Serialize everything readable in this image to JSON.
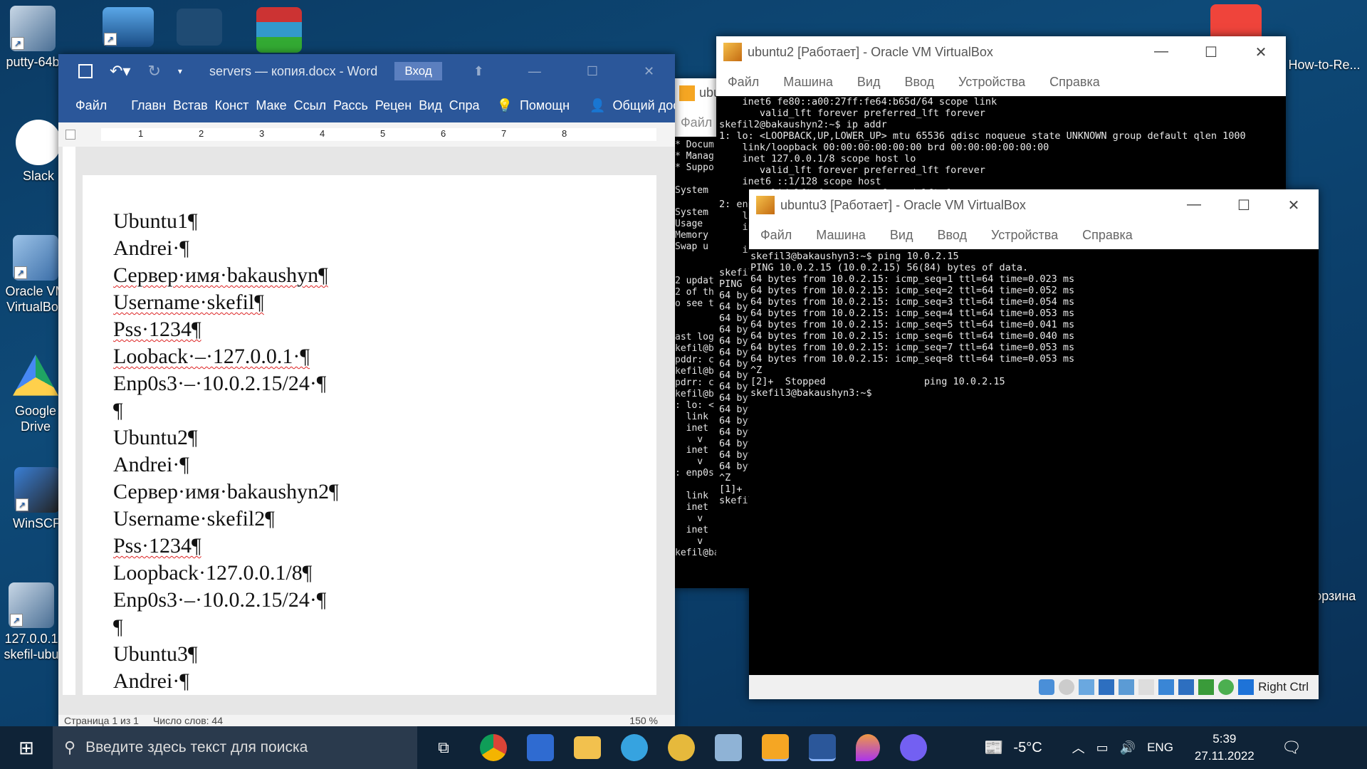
{
  "desktop": {
    "icons": [
      {
        "label": "putty-64b"
      },
      {
        "label": "Slack"
      },
      {
        "label": "Oracle VM VirtualBox"
      },
      {
        "label": "Google Drive"
      },
      {
        "label": "WinSCP"
      },
      {
        "label": "127.0.0.1 skefil-ubu"
      },
      {
        "label": "How-to-Re..."
      },
      {
        "label": "Корзина"
      }
    ]
  },
  "word": {
    "title": "servers — копия.docx - Word",
    "signin": "Вход",
    "tabs": [
      "Файл",
      "Главн",
      "Встав",
      "Конст",
      "Маке",
      "Ссыл",
      "Рассь",
      "Рецен",
      "Вид",
      "Спра"
    ],
    "help": "Помощн",
    "share": "Общий доступ",
    "ruler": [
      "1",
      "2",
      "3",
      "4",
      "5",
      "6",
      "7",
      "8"
    ],
    "paragraphs": [
      "Ubuntu1¶",
      "Andrei·¶",
      "Сервер·имя·bakaushyn¶",
      "Username·skefil¶",
      "Pss·1234¶",
      "Looback·–·127.0.0.1·¶",
      "Enp0s3·–·10.0.2.15/24·¶",
      "¶",
      "Ubuntu2¶",
      "Andrei·¶",
      "Сервер·имя·bakaushyn2¶",
      "Username·skefil2¶",
      "Pss·1234¶",
      "Loopback·127.0.0.1/8¶",
      "Enp0s3·–·10.0.2.15/24·¶",
      "¶",
      "Ubuntu3¶",
      "Andrei·¶"
    ],
    "status": {
      "page": "Страница 1 из 1",
      "words": "Число слов: 44",
      "zoom": "150 %"
    }
  },
  "vb_back": {
    "title": "ubu",
    "menu": "Файл",
    "lines": [
      "* Docum",
      "* Manag",
      "* Suppo",
      "",
      "System",
      "",
      "System",
      "Usage",
      "Memory",
      "Swap u",
      "",
      "",
      "2 updat",
      "2 of th",
      "o see t",
      "",
      "",
      "ast log",
      "kefil@b",
      "pddr: c",
      "kefil@b",
      "pdrr: c",
      "kefil@b",
      ": lo: <",
      "  link",
      "  inet",
      "    v",
      "  inet",
      "    v",
      ": enp0s",
      "",
      "  link",
      "  inet",
      "    v",
      "  inet",
      "    v",
      "kefil@bakaush"
    ]
  },
  "ubuntu2": {
    "title": "ubuntu2 [Работает] - Oracle VM VirtualBox",
    "menu": [
      "Файл",
      "Машина",
      "Вид",
      "Ввод",
      "Устройства",
      "Справка"
    ],
    "lines": [
      "    inet6 fe80::a00:27ff:fe64:b65d/64 scope link",
      "       valid_lft forever preferred_lft forever",
      "skefil2@bakaushyn2:~$ ip addr",
      "1: lo: <LOOPBACK,UP,LOWER_UP> mtu 65536 qdisc noqueue state UNKNOWN group default qlen 1000",
      "    link/loopback 00:00:00:00:00:00 brd 00:00:00:00:00:00",
      "    inet 127.0.0.1/8 scope host lo",
      "       valid_lft forever preferred_lft forever",
      "    inet6 ::1/128 scope host",
      "       valid_lft forever preferred_lft forever",
      "2: enp",
      "    li",
      "    in",
      "",
      "    in",
      "",
      "skefil",
      "PING",
      "64 byt",
      "64 byt",
      "64 byt",
      "64 byt",
      "64 byt",
      "64 byt",
      "64 byt",
      "64 byt",
      "64 byt",
      "64 byt",
      "64 byt",
      "64 byt",
      "64 byt",
      "64 byt",
      "64 byt",
      "64 byt",
      "^Z",
      "[1]+",
      "skefil"
    ]
  },
  "ubuntu3": {
    "title": "ubuntu3 [Работает] - Oracle VM VirtualBox",
    "menu": [
      "Файл",
      "Машина",
      "Вид",
      "Ввод",
      "Устройства",
      "Справка"
    ],
    "lines": [
      "skefil3@bakaushyn3:~$ ping 10.0.2.15",
      "PING 10.0.2.15 (10.0.2.15) 56(84) bytes of data.",
      "64 bytes from 10.0.2.15: icmp_seq=1 ttl=64 time=0.023 ms",
      "64 bytes from 10.0.2.15: icmp_seq=2 ttl=64 time=0.052 ms",
      "64 bytes from 10.0.2.15: icmp_seq=3 ttl=64 time=0.054 ms",
      "64 bytes from 10.0.2.15: icmp_seq=4 ttl=64 time=0.053 ms",
      "64 bytes from 10.0.2.15: icmp_seq=5 ttl=64 time=0.041 ms",
      "64 bytes from 10.0.2.15: icmp_seq=6 ttl=64 time=0.040 ms",
      "64 bytes from 10.0.2.15: icmp_seq=7 ttl=64 time=0.053 ms",
      "64 bytes from 10.0.2.15: icmp_seq=8 ttl=64 time=0.053 ms",
      "^Z",
      "[2]+  Stopped                 ping 10.0.2.15",
      "skefil3@bakaushyn3:~$ "
    ],
    "hostkey": "Right Ctrl"
  },
  "taskbar": {
    "search": "Введите здесь текст для поиска",
    "weather": "-5°C",
    "lang": "ENG",
    "time": "5:39",
    "date": "27.11.2022"
  }
}
